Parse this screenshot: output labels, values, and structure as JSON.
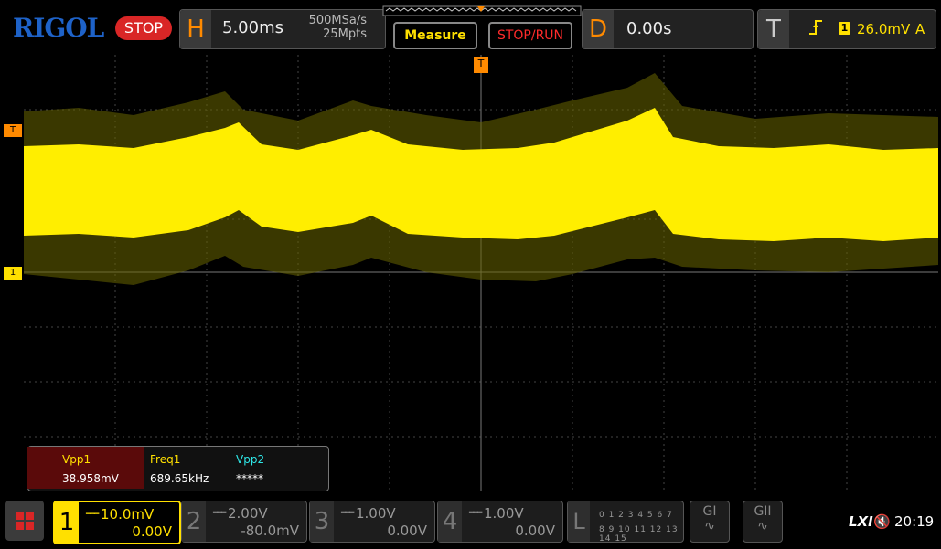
{
  "brand": "RIGOL",
  "run_state": "STOP",
  "horizontal": {
    "letter": "H",
    "timebase": "5.00ms",
    "sample_rate": "500MSa/s",
    "memory_depth": "25Mpts"
  },
  "buttons": {
    "measure": "Measure",
    "stop_run": "STOP/RUN"
  },
  "delay": {
    "letter": "D",
    "value": "0.00s"
  },
  "trigger": {
    "letter": "T",
    "source_channel": "1",
    "level": "26.0mV",
    "mode": "A"
  },
  "markers": {
    "trigger": "T",
    "channel1": "1"
  },
  "measurements": [
    {
      "name": "Vpp1",
      "value": "38.958mV",
      "color": "#ffe000"
    },
    {
      "name": "Freq1",
      "value": "689.65kHz",
      "color": "#ffe000"
    },
    {
      "name": "Vpp2",
      "value": "*****",
      "color": "#2ee6e6"
    }
  ],
  "channels": [
    {
      "num": "1",
      "scale": "10.0mV",
      "offset": "0.00V",
      "active": true
    },
    {
      "num": "2",
      "scale": "2.00V",
      "offset": "-80.0mV",
      "active": false
    },
    {
      "num": "3",
      "scale": "1.00V",
      "offset": "0.00V",
      "active": false
    },
    {
      "num": "4",
      "scale": "1.00V",
      "offset": "0.00V",
      "active": false
    }
  ],
  "logic": {
    "letter": "L",
    "row1": "0 1 2 3  4 5 6 7",
    "row2": "8 9 10 11 12 13 14 15"
  },
  "generators": [
    "GI",
    "GII"
  ],
  "status": {
    "lxi": "LXI",
    "time": "20:19"
  },
  "colors": {
    "channel1": "#ffe000",
    "trigger": "#ff8a00",
    "stop": "#d92626",
    "brand": "#1e62c8"
  }
}
